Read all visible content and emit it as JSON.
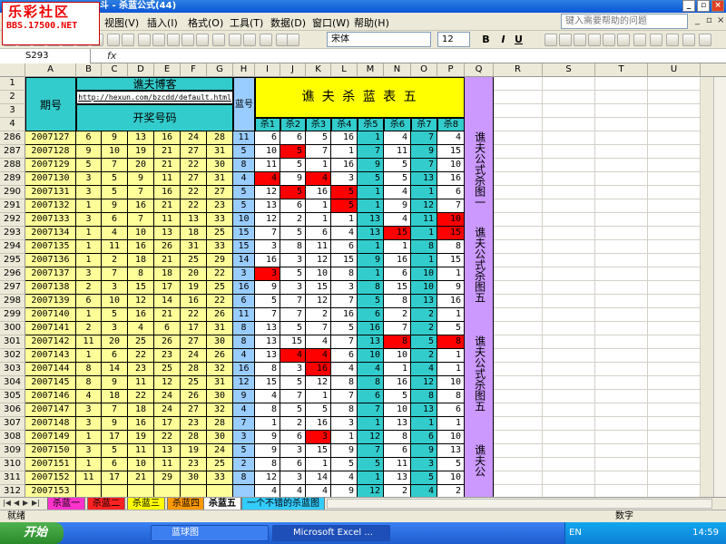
{
  "window": {
    "title": "斗 - 杀蓝公式(44)"
  },
  "logo": {
    "line1": "乐彩社区",
    "line2": "BBS.17500.NET"
  },
  "menu": [
    "视图(V)",
    "插入(I)",
    "格式(O)",
    "工具(T)",
    "数据(D)",
    "窗口(W)",
    "帮助(H)"
  ],
  "help_placeholder": "键入需要帮助的问题",
  "font": {
    "name": "宋体",
    "size": "12"
  },
  "format_buttons": [
    "B",
    "I",
    "U"
  ],
  "namebox": "S293",
  "fx": "fx",
  "columns": [
    "A",
    "B",
    "C",
    "D",
    "E",
    "F",
    "G",
    "H",
    "I",
    "J",
    "K",
    "L",
    "M",
    "N",
    "O",
    "P",
    "Q",
    "R",
    "S",
    "T",
    "U"
  ],
  "header": {
    "row_nums": [
      "1",
      "2",
      "3",
      "4"
    ],
    "blog_name": "谯夫博客",
    "url": "http://hexun.com/bzcdd/default.html",
    "kaijiang": "开奖号码",
    "qihao": "期号",
    "lanhao": "蓝号",
    "table_title": "谯 夫 杀 蓝 表 五",
    "kills": [
      "杀1",
      "杀2",
      "杀3",
      "杀4",
      "杀5",
      "杀6",
      "杀7",
      "杀8"
    ]
  },
  "side_texts": [
    "谯夫公式杀图一",
    "谯夫公式杀图五",
    "谯夫公式杀图五",
    "谯夫公"
  ],
  "rows": [
    {
      "r": "286",
      "id": "2007127",
      "n": [
        "6",
        "9",
        "13",
        "16",
        "24",
        "28"
      ],
      "b": "11",
      "k": [
        "6",
        "6",
        "5",
        "16",
        "1",
        "4",
        "7",
        "4"
      ],
      "red": []
    },
    {
      "r": "287",
      "id": "2007128",
      "n": [
        "9",
        "10",
        "19",
        "21",
        "27",
        "31"
      ],
      "b": "5",
      "k": [
        "10",
        "5",
        "7",
        "1",
        "7",
        "11",
        "9",
        "15"
      ],
      "red": [
        1
      ]
    },
    {
      "r": "288",
      "id": "2007129",
      "n": [
        "5",
        "7",
        "20",
        "21",
        "22",
        "30"
      ],
      "b": "8",
      "k": [
        "11",
        "5",
        "1",
        "16",
        "9",
        "5",
        "7",
        "10"
      ],
      "red": []
    },
    {
      "r": "289",
      "id": "2007130",
      "n": [
        "3",
        "5",
        "9",
        "11",
        "27",
        "31"
      ],
      "b": "4",
      "k": [
        "4",
        "9",
        "4",
        "3",
        "5",
        "5",
        "13",
        "16"
      ],
      "red": [
        0,
        2
      ]
    },
    {
      "r": "290",
      "id": "2007131",
      "n": [
        "3",
        "5",
        "7",
        "16",
        "22",
        "27"
      ],
      "b": "5",
      "k": [
        "12",
        "5",
        "16",
        "5",
        "1",
        "4",
        "1",
        "6"
      ],
      "red": [
        1,
        3
      ]
    },
    {
      "r": "291",
      "id": "2007132",
      "n": [
        "1",
        "9",
        "16",
        "21",
        "22",
        "23"
      ],
      "b": "5",
      "k": [
        "13",
        "6",
        "1",
        "5",
        "1",
        "9",
        "12",
        "7"
      ],
      "red": [
        3
      ]
    },
    {
      "r": "292",
      "id": "2007133",
      "n": [
        "3",
        "6",
        "7",
        "11",
        "13",
        "33"
      ],
      "b": "10",
      "k": [
        "12",
        "2",
        "1",
        "1",
        "13",
        "4",
        "11",
        "10"
      ],
      "red": [
        7
      ]
    },
    {
      "r": "293",
      "id": "2007134",
      "n": [
        "1",
        "4",
        "10",
        "13",
        "18",
        "25"
      ],
      "b": "15",
      "k": [
        "7",
        "5",
        "6",
        "4",
        "13",
        "15",
        "1",
        "15"
      ],
      "red": [
        5,
        7
      ]
    },
    {
      "r": "294",
      "id": "2007135",
      "n": [
        "1",
        "11",
        "16",
        "26",
        "31",
        "33"
      ],
      "b": "15",
      "k": [
        "3",
        "8",
        "11",
        "6",
        "1",
        "1",
        "8",
        "8"
      ],
      "red": []
    },
    {
      "r": "295",
      "id": "2007136",
      "n": [
        "1",
        "2",
        "18",
        "21",
        "25",
        "29"
      ],
      "b": "14",
      "k": [
        "16",
        "3",
        "12",
        "15",
        "9",
        "16",
        "1",
        "15"
      ],
      "red": []
    },
    {
      "r": "296",
      "id": "2007137",
      "n": [
        "3",
        "7",
        "8",
        "18",
        "20",
        "22"
      ],
      "b": "3",
      "k": [
        "3",
        "5",
        "10",
        "8",
        "1",
        "6",
        "10",
        "1"
      ],
      "red": [
        0
      ]
    },
    {
      "r": "297",
      "id": "2007138",
      "n": [
        "2",
        "3",
        "15",
        "17",
        "19",
        "25"
      ],
      "b": "16",
      "k": [
        "9",
        "3",
        "15",
        "3",
        "8",
        "15",
        "10",
        "9"
      ],
      "red": []
    },
    {
      "r": "298",
      "id": "2007139",
      "n": [
        "6",
        "10",
        "12",
        "14",
        "16",
        "22"
      ],
      "b": "6",
      "k": [
        "5",
        "7",
        "12",
        "7",
        "5",
        "8",
        "13",
        "16"
      ],
      "red": []
    },
    {
      "r": "299",
      "id": "2007140",
      "n": [
        "1",
        "5",
        "16",
        "21",
        "22",
        "26"
      ],
      "b": "11",
      "k": [
        "7",
        "7",
        "2",
        "16",
        "6",
        "2",
        "2",
        "1"
      ],
      "red": []
    },
    {
      "r": "300",
      "id": "2007141",
      "n": [
        "2",
        "3",
        "4",
        "6",
        "17",
        "31"
      ],
      "b": "8",
      "k": [
        "13",
        "5",
        "7",
        "5",
        "16",
        "7",
        "2",
        "5"
      ],
      "red": []
    },
    {
      "r": "301",
      "id": "2007142",
      "n": [
        "11",
        "20",
        "25",
        "26",
        "27",
        "30"
      ],
      "b": "8",
      "k": [
        "13",
        "15",
        "4",
        "7",
        "13",
        "8",
        "5",
        "8"
      ],
      "red": [
        5,
        7
      ]
    },
    {
      "r": "302",
      "id": "2007143",
      "n": [
        "1",
        "6",
        "22",
        "23",
        "24",
        "26"
      ],
      "b": "4",
      "k": [
        "13",
        "4",
        "4",
        "6",
        "10",
        "10",
        "2",
        "1"
      ],
      "red": [
        1,
        2
      ]
    },
    {
      "r": "303",
      "id": "2007144",
      "n": [
        "8",
        "14",
        "23",
        "25",
        "28",
        "32"
      ],
      "b": "16",
      "k": [
        "8",
        "3",
        "16",
        "4",
        "4",
        "1",
        "4",
        "1"
      ],
      "red": [
        2
      ]
    },
    {
      "r": "304",
      "id": "2007145",
      "n": [
        "8",
        "9",
        "11",
        "12",
        "25",
        "31"
      ],
      "b": "12",
      "k": [
        "15",
        "5",
        "12",
        "8",
        "8",
        "16",
        "12",
        "10"
      ],
      "red": []
    },
    {
      "r": "305",
      "id": "2007146",
      "n": [
        "4",
        "18",
        "22",
        "24",
        "26",
        "30"
      ],
      "b": "9",
      "k": [
        "4",
        "7",
        "1",
        "7",
        "6",
        "5",
        "8",
        "8"
      ],
      "red": []
    },
    {
      "r": "306",
      "id": "2007147",
      "n": [
        "3",
        "7",
        "18",
        "24",
        "27",
        "32"
      ],
      "b": "4",
      "k": [
        "8",
        "5",
        "5",
        "8",
        "7",
        "10",
        "13",
        "6"
      ],
      "red": []
    },
    {
      "r": "307",
      "id": "2007148",
      "n": [
        "3",
        "9",
        "16",
        "17",
        "23",
        "28"
      ],
      "b": "7",
      "k": [
        "1",
        "2",
        "16",
        "3",
        "1",
        "13",
        "1",
        "1"
      ],
      "red": []
    },
    {
      "r": "308",
      "id": "2007149",
      "n": [
        "1",
        "17",
        "19",
        "22",
        "28",
        "30"
      ],
      "b": "3",
      "k": [
        "9",
        "6",
        "3",
        "1",
        "12",
        "8",
        "6",
        "10"
      ],
      "red": [
        2
      ]
    },
    {
      "r": "309",
      "id": "2007150",
      "n": [
        "3",
        "5",
        "11",
        "13",
        "19",
        "24"
      ],
      "b": "5",
      "k": [
        "9",
        "3",
        "15",
        "9",
        "7",
        "6",
        "9",
        "13"
      ],
      "red": []
    },
    {
      "r": "310",
      "id": "2007151",
      "n": [
        "1",
        "6",
        "10",
        "11",
        "23",
        "25"
      ],
      "b": "2",
      "k": [
        "8",
        "6",
        "1",
        "5",
        "5",
        "11",
        "3",
        "5"
      ],
      "red": []
    },
    {
      "r": "311",
      "id": "2007152",
      "n": [
        "11",
        "17",
        "21",
        "29",
        "30",
        "33"
      ],
      "b": "8",
      "k": [
        "12",
        "3",
        "14",
        "4",
        "1",
        "13",
        "5",
        "10"
      ],
      "red": []
    },
    {
      "r": "312",
      "id": "2007153",
      "n": [
        "",
        "",
        "",
        "",
        "",
        ""
      ],
      "b": "",
      "k": [
        "4",
        "4",
        "4",
        "9",
        "12",
        "2",
        "4",
        "2"
      ],
      "red": []
    }
  ],
  "sheet_tabs": [
    {
      "label": "杀蓝一",
      "color": "#ff33cc"
    },
    {
      "label": "杀蓝二",
      "color": "#ff2222"
    },
    {
      "label": "杀蓝三",
      "color": "#ffff00"
    },
    {
      "label": "杀蓝四",
      "color": "#ff9900"
    },
    {
      "label": "杀蓝五",
      "color": "#ffffff"
    },
    {
      "label": "一个不错的杀蓝图",
      "color": "#33ccff"
    }
  ],
  "status": {
    "left": "就绪",
    "right": "数字"
  },
  "taskbar": {
    "start": "开始",
    "tasks": [
      "蓝球图",
      "Microsoft Excel ..."
    ],
    "lang": "EN",
    "time": "14:59"
  },
  "colors": {
    "yellow": "#ffff99",
    "cyan_header": "#33cccc",
    "kill_header": "#ffff00",
    "blue_col": "#99ccff",
    "purple": "#cc99ff",
    "red": "#ff0000",
    "kill5_cyan": "#33cccc"
  }
}
